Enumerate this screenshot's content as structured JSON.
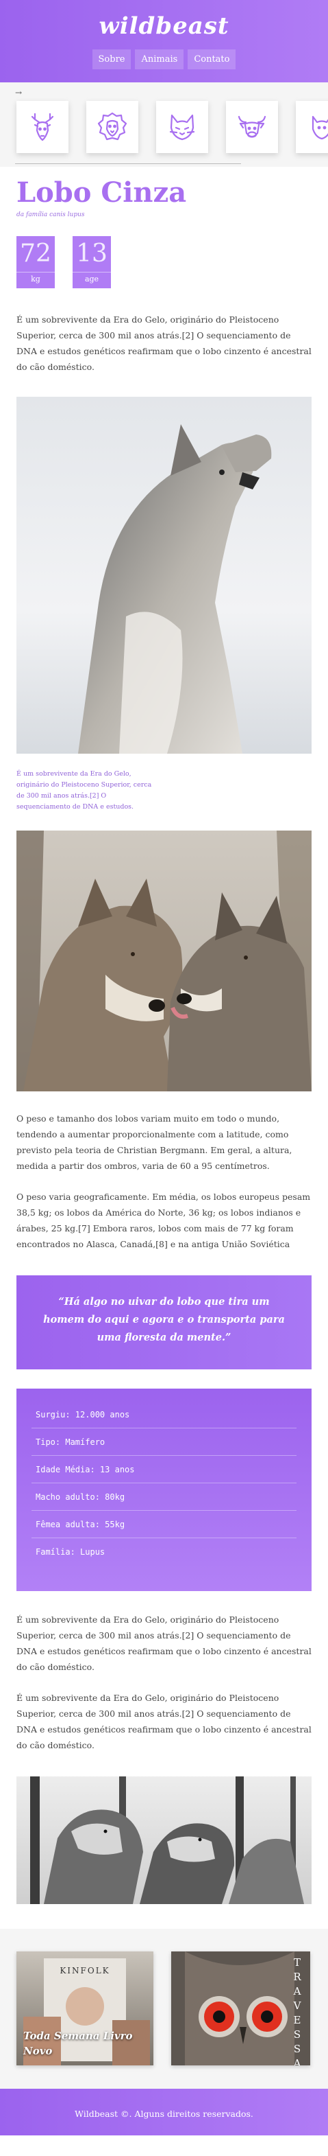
{
  "header": {
    "logo": "wildbeast",
    "nav": [
      "Sobre",
      "Animais",
      "Contato"
    ]
  },
  "strip": {
    "arrow": "→",
    "animals": [
      "deer-icon",
      "lion-icon",
      "cat-icon",
      "bull-icon",
      "animal-icon"
    ],
    "accent": "#a86ff0"
  },
  "article": {
    "title": "Lobo Cinza",
    "subtitle": "da família canis lupus",
    "stats": [
      {
        "value": "72",
        "unit": "kg"
      },
      {
        "value": "13",
        "unit": "age"
      }
    ],
    "para1": "É um sobrevivente da Era do Gelo, originário do Pleistoceno Superior, cerca de 300 mil anos atrás.[2] O sequenciamento de DNA e estudos genéticos reafirmam que o lobo cinzento é ancestral do cão doméstico.",
    "caption": "É um sobrevivente da Era do Gelo, originário do Pleistoceno Superior, cerca de 300 mil anos atrás.[2] O sequenciamento de DNA e estudos.",
    "para2": "O peso e tamanho dos lobos variam muito em todo o mundo, tendendo a aumentar proporcionalmente com a latitude, como previsto pela teoria de Christian Bergmann. Em geral, a altura, medida a partir dos ombros, varia de 60 a 95 centímetros.",
    "para3": "O peso varia geograficamente. Em média, os lobos europeus pesam 38,5 kg; os lobos da América do Norte, 36 kg; os lobos indianos e árabes, 25 kg.[7] Embora raros, lobos com mais de 77 kg foram encontrados no Alasca, Canadá,[8] e na antiga União Soviética",
    "quote": "“Há algo no uivar do lobo que tira um homem do aqui e agora e o transporta para uma floresta da mente.”",
    "facts": [
      "Surgiu: 12.000 anos",
      "Tipo: Mamífero",
      "Idade Média: 13 anos",
      "Macho adulto: 80kg",
      "Fêmea adulta: 55kg",
      "Família: Lupus"
    ],
    "para4": "É um sobrevivente da Era do Gelo, originário do Pleistoceno Superior, cerca de 300 mil anos atrás.[2] O sequenciamento de DNA e estudos genéticos reafirmam que o lobo cinzento é ancestral do cão doméstico.",
    "para5": "É um sobrevivente da Era do Gelo, originário do Pleistoceno Superior, cerca de 300 mil anos atrás.[2] O sequenciamento de DNA e estudos genéticos reafirmam que o lobo cinzento é ancestral do cão doméstico."
  },
  "promos": {
    "left_brand": "KINFOLK",
    "left_text": "Toda Semana Livro Novo",
    "right_vertical": "TRAVESSA"
  },
  "footer": {
    "text": "Wildbeast ©. Alguns direitos reservados."
  }
}
